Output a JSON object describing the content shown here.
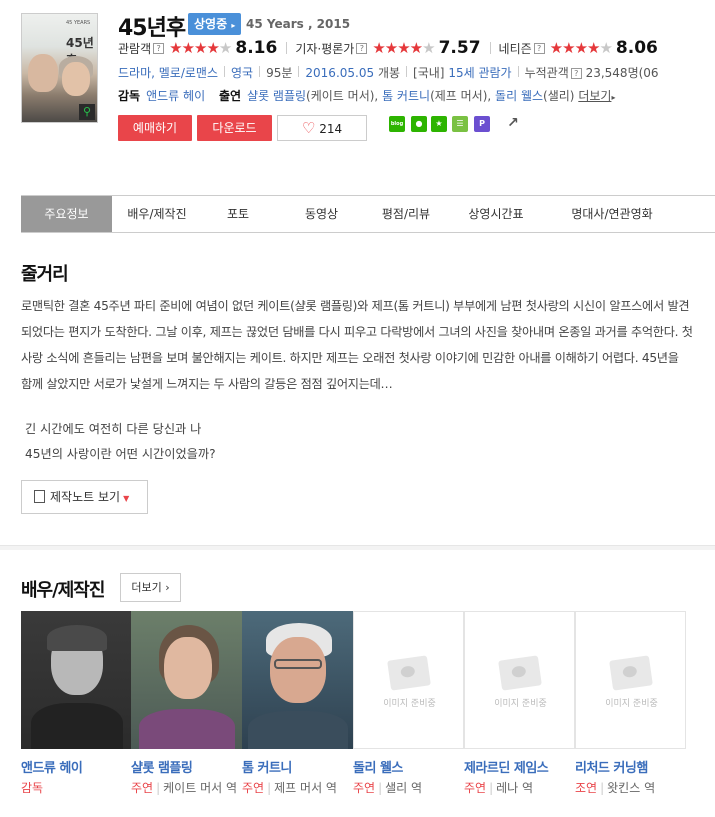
{
  "movie": {
    "title": "45년후",
    "status_badge": "상영중",
    "english_title": "45 Years , 2015",
    "poster_title": "45 YEARS",
    "poster_number": "45년후"
  },
  "ratings": [
    {
      "label": "관람객",
      "stars": 4.1,
      "score": "8.16"
    },
    {
      "label": "기자·평론가",
      "stars": 3.8,
      "score": "7.57"
    },
    {
      "label": "네티즌",
      "stars": 4.0,
      "score": "8.06"
    }
  ],
  "info": {
    "genre": "드라마, 멜로/로맨스",
    "country": "영국",
    "runtime": "95분",
    "release": "2016.05.05",
    "release_suffix": "개봉",
    "rating_prefix": "[국내]",
    "rating": "15세 관람가",
    "audience_label": "누적관객",
    "audience": "23,548명(06"
  },
  "crew": {
    "director_label": "감독",
    "director": "앤드류 헤이",
    "cast_label": "출연",
    "cast1": "샬롯 램플링",
    "cast1_role": "(케이트 머서),",
    "cast2": "톰 커트니",
    "cast2_role": "(제프 머서),",
    "cast3": "돌리 웰스",
    "cast3_role": "(샐리)",
    "more": "더보기"
  },
  "actions": {
    "reserve": "예매하기",
    "download": "다운로드",
    "likes": "214"
  },
  "share": [
    {
      "name": "blog",
      "color": "#2db400"
    },
    {
      "name": "band",
      "color": "#2db400"
    },
    {
      "name": "star",
      "color": "#2db400"
    },
    {
      "name": "list",
      "color": "#7ac143"
    },
    {
      "name": "post",
      "color": "#6b4fd0"
    }
  ],
  "tabs": [
    "주요정보",
    "배우/제작진",
    "포토",
    "동영상",
    "평점/리뷰",
    "상영시간표",
    "명대사/연관영화"
  ],
  "synopsis": {
    "heading": "줄거리",
    "text": "로맨틱한 결혼 45주년 파티 준비에 여념이 없던 케이트(샬롯 램플링)와 제프(톰 커트니) 부부에게 남편 첫사랑의 시신이 알프스에서 발견되었다는 편지가 도착한다. 그날 이후, 제프는 끊었던 담배를 다시 피우고 다락방에서 그녀의 사진을 찾아내며 온종일 과거를 추억한다. 첫사랑 소식에 흔들리는 남편을 보며 불안해지는 케이트. 하지만 제프는 오래전 첫사랑 이야기에 민감한 아내를 이해하기 어렵다. 45년을 함께 살았지만 서로가 낯설게 느껴지는 두 사람의 갈등은 점점 깊어지는데…",
    "tagline1": "긴 시간에도 여전히 다른 당신과 나",
    "tagline2": "45년의 사랑이란 어떤 시간이었을까?",
    "note_button": "제작노트 보기"
  },
  "cast_section": {
    "heading": "배우/제작진",
    "more": "더보기",
    "placeholder_text": "이미지 준비중",
    "people": [
      {
        "name": "앤드류 헤이",
        "position": "감독",
        "role": ""
      },
      {
        "name": "샬롯 램플링",
        "position": "주연",
        "role": "케이트 머서 역"
      },
      {
        "name": "톰 커트니",
        "position": "주연",
        "role": "제프 머서 역"
      },
      {
        "name": "돌리 웰스",
        "position": "주연",
        "role": "샐리 역"
      },
      {
        "name": "제라르딘 제임스",
        "position": "주연",
        "role": "레나 역"
      },
      {
        "name": "리처드 커닝햄",
        "position": "조연",
        "role": "왓킨스 역"
      }
    ]
  }
}
